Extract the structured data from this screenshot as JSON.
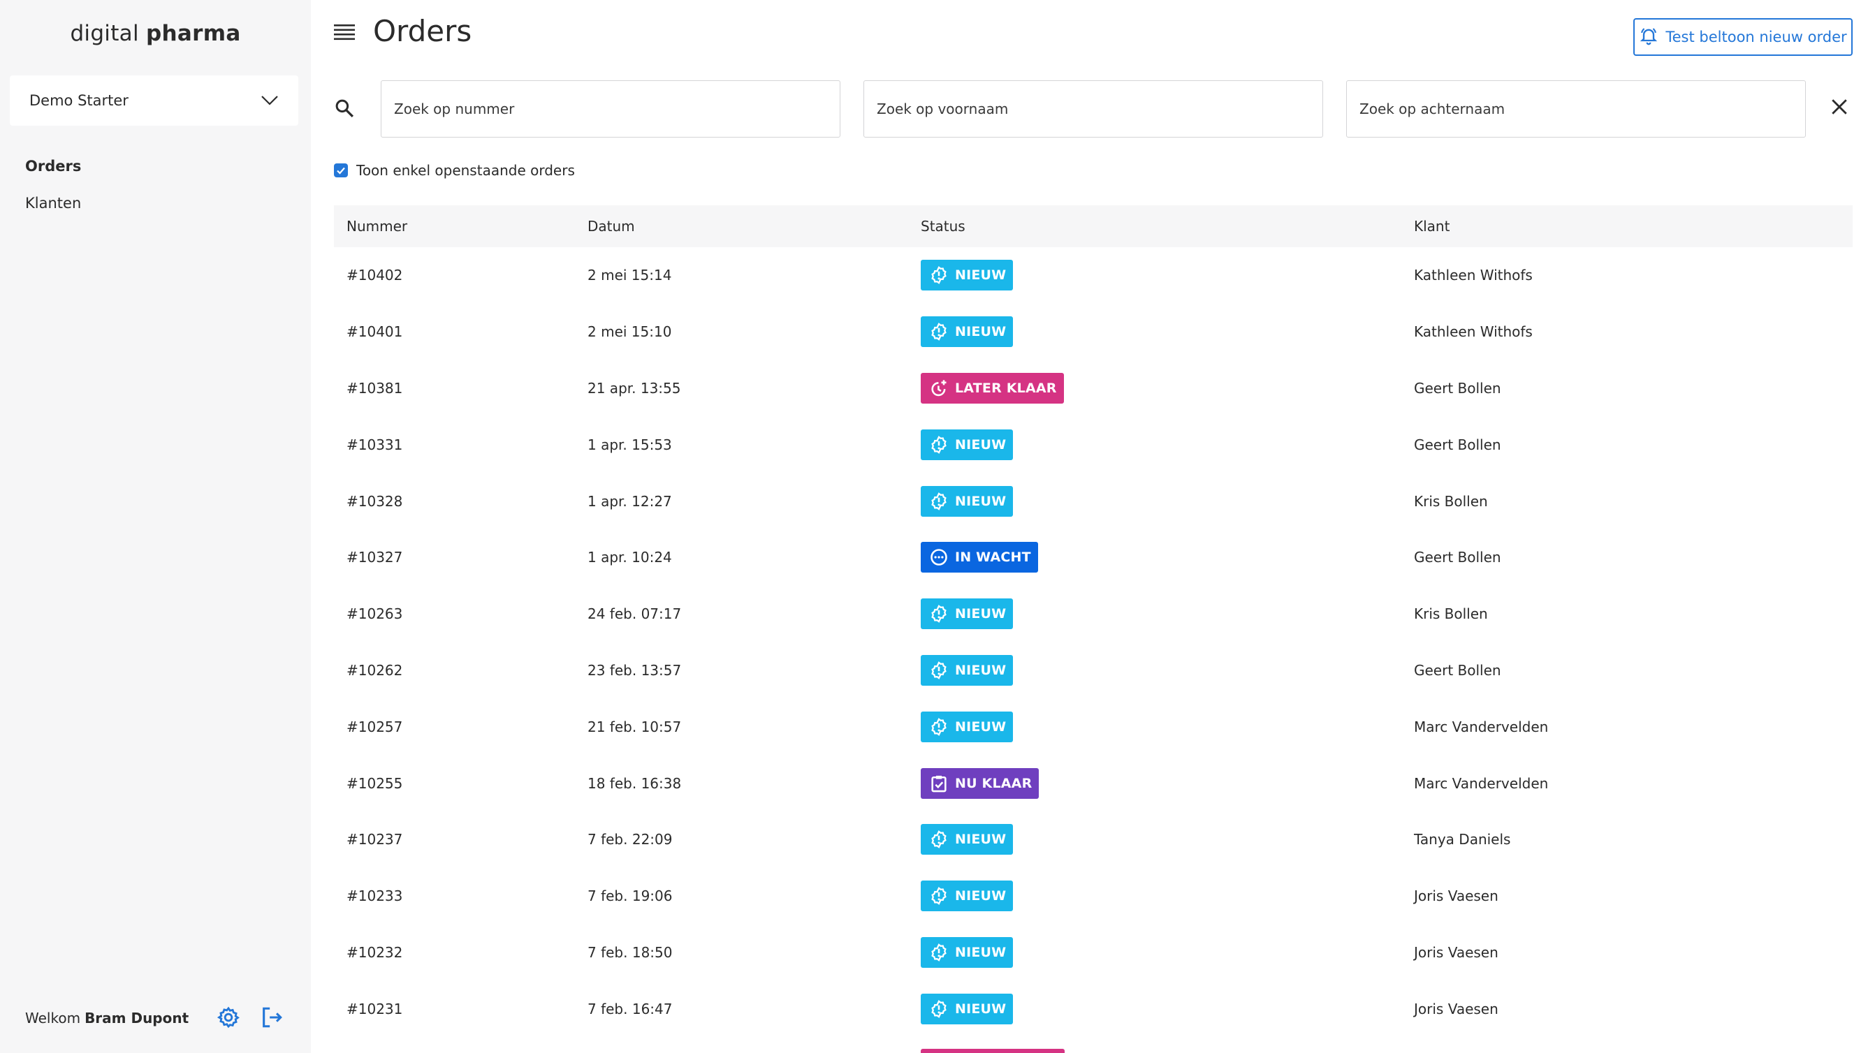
{
  "brand": {
    "part1": "digital",
    "part2": "pharma"
  },
  "sidebar": {
    "store": "Demo Starter",
    "items": [
      {
        "label": "Orders",
        "active": true
      },
      {
        "label": "Klanten",
        "active": false
      }
    ],
    "welcome": "Welkom",
    "user": "Bram Dupont"
  },
  "header": {
    "title": "Orders",
    "ring_button": "Test beltoon nieuw order"
  },
  "search": {
    "number_placeholder": "Zoek op nummer",
    "firstname_placeholder": "Zoek op voornaam",
    "lastname_placeholder": "Zoek op achternaam"
  },
  "filter": {
    "label": "Toon enkel openstaande orders",
    "checked": true
  },
  "table": {
    "columns": [
      "Nummer",
      "Datum",
      "Status",
      "Klant"
    ],
    "rows": [
      {
        "number": "#10402",
        "date": "2 mei 15:14",
        "status": "NIEUW",
        "customer": "Kathleen Withofs"
      },
      {
        "number": "#10401",
        "date": "2 mei 15:10",
        "status": "NIEUW",
        "customer": "Kathleen Withofs"
      },
      {
        "number": "#10381",
        "date": "21 apr. 13:55",
        "status": "LATER KLAAR",
        "customer": "Geert Bollen"
      },
      {
        "number": "#10331",
        "date": "1 apr. 15:53",
        "status": "NIEUW",
        "customer": "Geert Bollen"
      },
      {
        "number": "#10328",
        "date": "1 apr. 12:27",
        "status": "NIEUW",
        "customer": "Kris Bollen"
      },
      {
        "number": "#10327",
        "date": "1 apr. 10:24",
        "status": "IN WACHT",
        "customer": "Geert Bollen"
      },
      {
        "number": "#10263",
        "date": "24 feb. 07:17",
        "status": "NIEUW",
        "customer": "Kris Bollen"
      },
      {
        "number": "#10262",
        "date": "23 feb. 13:57",
        "status": "NIEUW",
        "customer": "Geert Bollen"
      },
      {
        "number": "#10257",
        "date": "21 feb. 10:57",
        "status": "NIEUW",
        "customer": "Marc Vandervelden"
      },
      {
        "number": "#10255",
        "date": "18 feb. 16:38",
        "status": "NU KLAAR",
        "customer": "Marc Vandervelden"
      },
      {
        "number": "#10237",
        "date": "7 feb. 22:09",
        "status": "NIEUW",
        "customer": "Tanya Daniels"
      },
      {
        "number": "#10233",
        "date": "7 feb. 19:06",
        "status": "NIEUW",
        "customer": "Joris Vaesen"
      },
      {
        "number": "#10232",
        "date": "7 feb. 18:50",
        "status": "NIEUW",
        "customer": "Joris Vaesen"
      },
      {
        "number": "#10231",
        "date": "7 feb. 16:47",
        "status": "NIEUW",
        "customer": "Joris Vaesen"
      }
    ]
  },
  "colors": {
    "accent": "#2477d8",
    "nieuw": "#1ab7ea",
    "later_klaar": "#d53383",
    "in_wacht": "#0a66e0",
    "nu_klaar": "#6f3fbf"
  },
  "icons": {
    "menu": "menu-icon",
    "search": "search-icon",
    "clear": "close-icon",
    "bell": "bell-icon",
    "chevron": "chevron-down-icon",
    "settings": "gear-icon",
    "logout": "logout-icon"
  }
}
